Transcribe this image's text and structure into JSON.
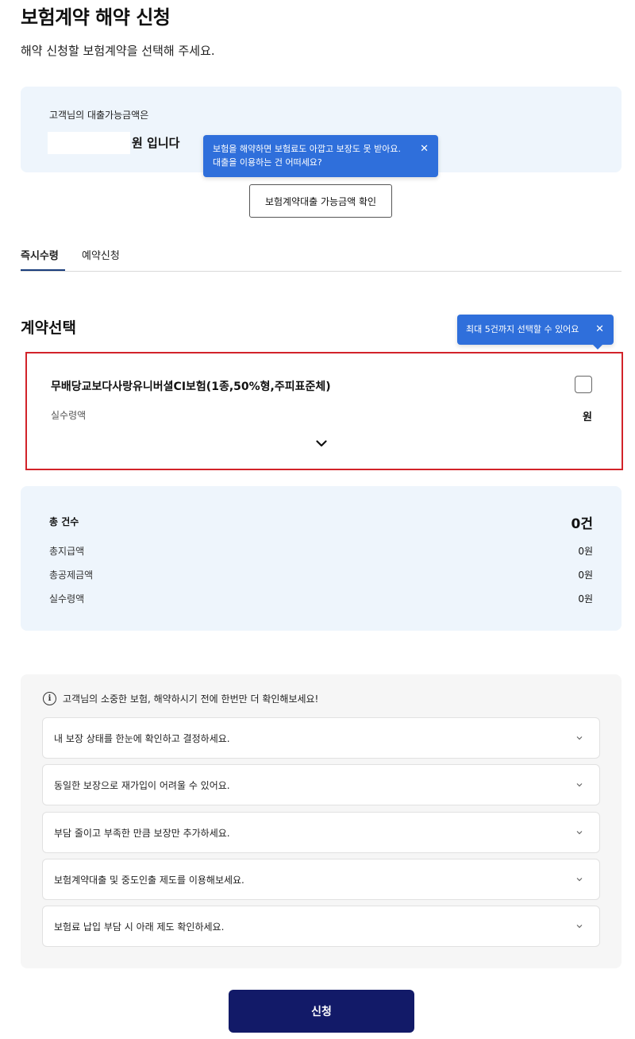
{
  "header": {
    "title": "보험계약 해약 신청",
    "subtitle": "해약 신청할 보험계약을 선택해 주세요."
  },
  "loan": {
    "label": "고객님의 대출가능금액은",
    "amount_suffix": "원 입니다",
    "check_button": "보험계약대출 가능금액 확인",
    "tooltip_line1": "보험을 해약하면 보험료도 아깝고 보장도 못 받아요.",
    "tooltip_line2": "대출을 이용하는 건 어떠세요?"
  },
  "tabs": [
    {
      "label": "즉시수령",
      "active": true
    },
    {
      "label": "예약신청",
      "active": false
    }
  ],
  "contract_section": {
    "title": "계약선택",
    "tooltip": "최대 5건까지 선택할 수 있어요",
    "contracts": [
      {
        "name": "무배당교보다사랑유니버셜CI보험(1종,50%형,주피표준체)",
        "net_label": "실수령액",
        "net_value": "원",
        "selected": false
      }
    ]
  },
  "summary": {
    "count_label": "총 건수",
    "count_value": "0건",
    "rows": [
      {
        "label": "총지급액",
        "value": "0원"
      },
      {
        "label": "총공제금액",
        "value": "0원"
      },
      {
        "label": "실수령액",
        "value": "0원"
      }
    ]
  },
  "notice": {
    "title": "고객님의 소중한 보험, 해약하시기 전에 한번만 더 확인해보세요!",
    "items": [
      "내 보장 상태를 한눈에 확인하고 결정하세요.",
      "동일한 보장으로 재가입이 어려울 수 있어요.",
      "부담 줄이고 부족한 만큼 보장만 추가하세요.",
      "보험계약대출 및 중도인출 제도를 이용해보세요.",
      "보험료 납입 부담 시 아래 제도 확인하세요."
    ]
  },
  "apply_button": "신청",
  "icons": {
    "close": "close-icon",
    "chevron": "chevron-down-icon",
    "info": "info-icon"
  },
  "colors": {
    "primary_navy": "#121a68",
    "tooltip_blue": "#2f6fdb",
    "panel_bg": "#eef5fc",
    "highlight_red": "#d2232a"
  }
}
